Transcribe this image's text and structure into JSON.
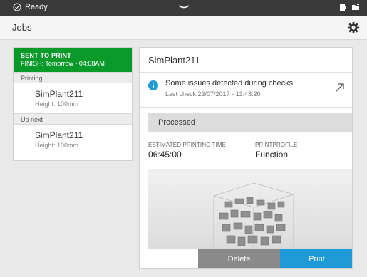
{
  "statusbar": {
    "status_text": "Ready",
    "icons": [
      "check-circle-icon",
      "handle-icon",
      "printer-status-icon",
      "folder-icon"
    ]
  },
  "header": {
    "title": "Jobs",
    "settings_icon": "gear-icon"
  },
  "left_panel": {
    "sent_title": "SENT TO PRINT",
    "sent_finish": "FINISH: Tomorrow - 04:08AM",
    "sent_color": "#0a9a2a",
    "printing_label": "Printing",
    "printing_job": {
      "name": "SimPlant211",
      "height": "Height: 100mm"
    },
    "upnext_label": "Up next",
    "upnext_job": {
      "name": "SimPlant211",
      "height": "Height: 100mm"
    }
  },
  "detail": {
    "title": "SimPlant211",
    "issue_text": "Some issues detected during checks",
    "last_check": "Last check 23/07/2017  -  13:48:20",
    "status": "Processed",
    "est_label": "ESTIMATED PRINTING TIME",
    "est_value": "06:45:00",
    "profile_label": "PRINTPROFILE",
    "profile_value": "Function",
    "delete_label": "Delete",
    "print_label": "Print",
    "print_color": "#1e9ad6",
    "delete_color": "#8a8a8a"
  }
}
